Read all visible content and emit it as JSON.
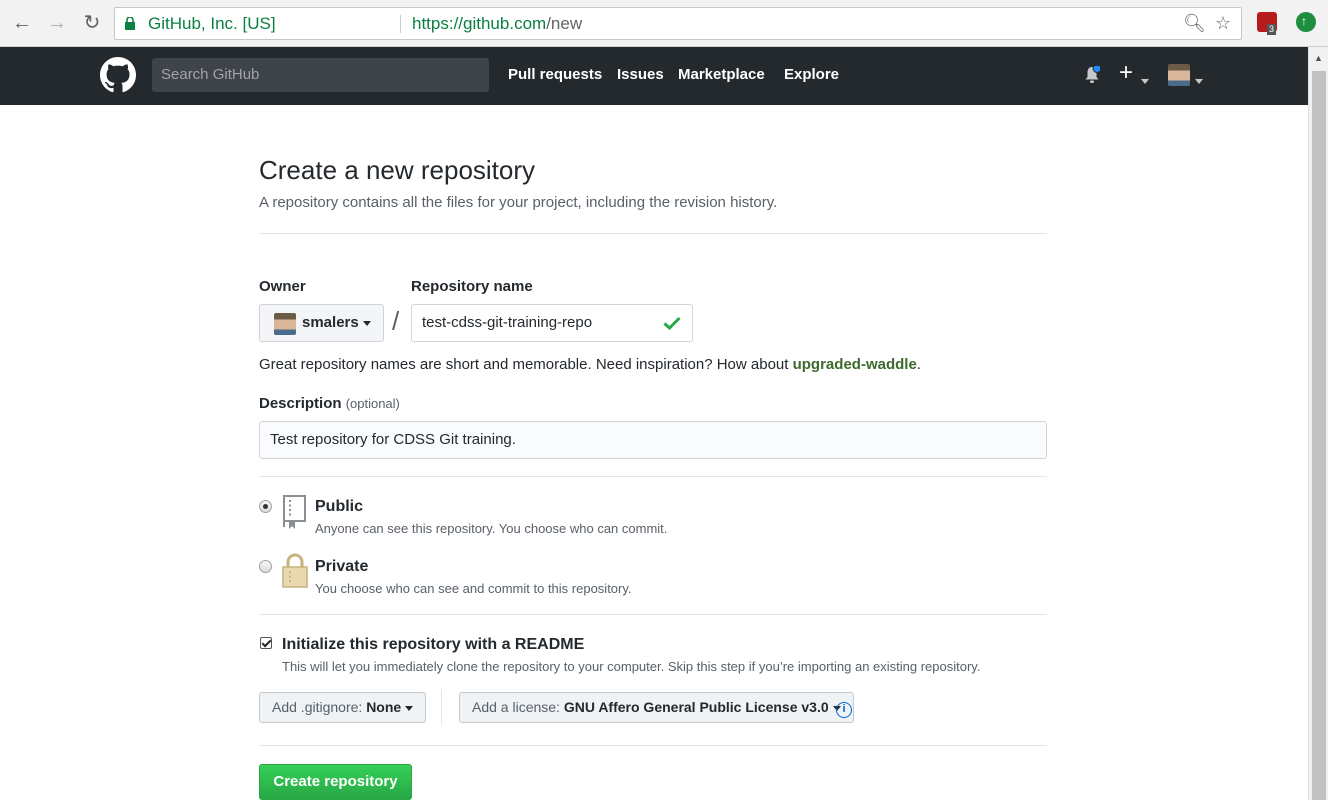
{
  "browser": {
    "site_identity": "GitHub, Inc. [US]",
    "url_host": "https://github.com",
    "url_path": "/new",
    "extension_badge": "3"
  },
  "header": {
    "search_placeholder": "Search GitHub",
    "nav": [
      "Pull requests",
      "Issues",
      "Marketplace",
      "Explore"
    ],
    "plus_label": "+"
  },
  "form": {
    "title": "Create a new repository",
    "subtitle": "A repository contains all the files for your project, including the revision history.",
    "owner_label": "Owner",
    "owner_value": "smalers",
    "slash": "/",
    "repo_name_label": "Repository name",
    "repo_name_value": "test-cdss-git-training-repo",
    "hint_prefix": "Great repository names are short and memorable. Need inspiration? How about ",
    "hint_suggestion": "upgraded-waddle",
    "hint_suffix": ".",
    "description_label": "Description",
    "description_optional": "(optional)",
    "description_value": "Test repository for CDSS Git training.",
    "visibility": {
      "public_title": "Public",
      "public_desc": "Anyone can see this repository. You choose who can commit.",
      "private_title": "Private",
      "private_desc": "You choose who can see and commit to this repository.",
      "selected": "Public"
    },
    "readme": {
      "label": "Initialize this repository with a README",
      "desc": "This will let you immediately clone the repository to your computer. Skip this step if you’re importing an existing repository.",
      "checked": true
    },
    "gitignore_prefix": "Add .gitignore:",
    "gitignore_value": "None",
    "license_prefix": "Add a license:",
    "license_value": "GNU Affero General Public License v3.0",
    "info_glyph": "i",
    "submit_label": "Create repository"
  },
  "colors": {
    "header_bg": "#24292e",
    "create_button": "#28a745",
    "check": "#28a745",
    "link_info": "#0366d6"
  }
}
